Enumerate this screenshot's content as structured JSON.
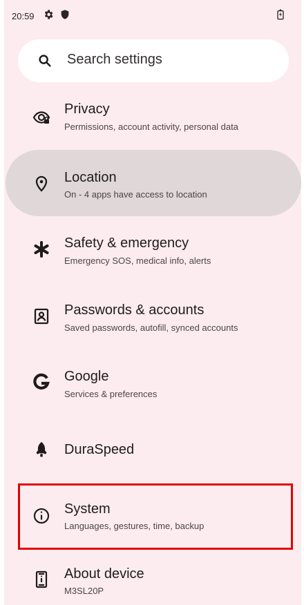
{
  "status_bar": {
    "time": "20:59",
    "icons": [
      "gear-icon",
      "shield-icon",
      "battery-icon"
    ]
  },
  "search": {
    "placeholder": "Search settings",
    "icon": "search-icon"
  },
  "settings": {
    "items": [
      {
        "icon": "eye-lock-icon",
        "title": "Privacy",
        "subtitle": "Permissions, account activity, personal data",
        "selected": false
      },
      {
        "icon": "location-pin-icon",
        "title": "Location",
        "subtitle": "On - 4 apps have access to location",
        "selected": true
      },
      {
        "icon": "asterisk-icon",
        "title": "Safety & emergency",
        "subtitle": "Emergency SOS, medical info, alerts",
        "selected": false
      },
      {
        "icon": "account-box-icon",
        "title": "Passwords & accounts",
        "subtitle": "Saved passwords, autofill, synced accounts",
        "selected": false
      },
      {
        "icon": "google-g-icon",
        "title": "Google",
        "subtitle": "Services & preferences",
        "selected": false
      },
      {
        "icon": "rocket-icon",
        "title": "DuraSpeed",
        "subtitle": "",
        "selected": false
      },
      {
        "icon": "info-icon",
        "title": "System",
        "subtitle": "Languages, gestures, time, backup",
        "selected": false,
        "annotated": true
      },
      {
        "icon": "phone-info-icon",
        "title": "About device",
        "subtitle": "M3SL20P",
        "selected": false
      }
    ]
  },
  "colors": {
    "background": "#fcecef",
    "selected_item": "#dfd7d8",
    "highlight_frame": "#e30000",
    "text_primary": "#1f1b1d",
    "text_secondary": "#4b4549"
  }
}
